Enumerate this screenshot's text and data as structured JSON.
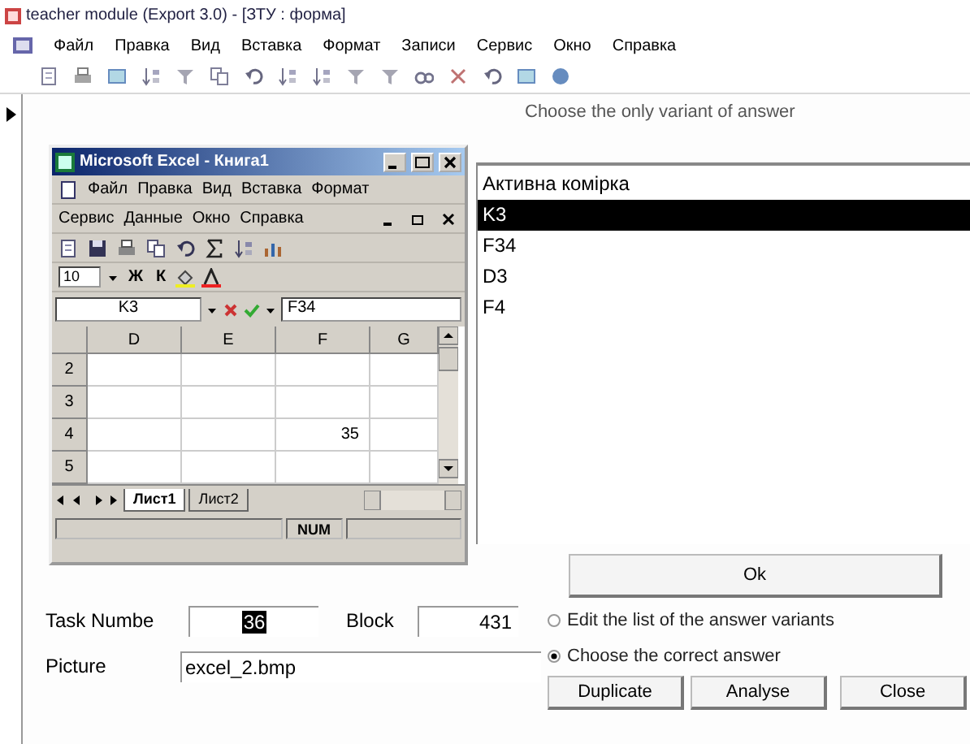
{
  "window": {
    "title": "teacher module (Export 3.0) - [ЗТУ : форма]"
  },
  "menu": [
    "Файл",
    "Правка",
    "Вид",
    "Вставка",
    "Формат",
    "Записи",
    "Сервис",
    "Окно",
    "Справка"
  ],
  "excel": {
    "title": "Microsoft Excel - Книга1",
    "menu_rows": [
      [
        "Файл",
        "Правка",
        "Вид",
        "Вставка",
        "Формат"
      ],
      [
        "Сервис",
        "Данные",
        "Окно",
        "Справка"
      ]
    ],
    "font_size": "10",
    "format_buttons": [
      "Ж",
      "К"
    ],
    "name_box": "K3",
    "formula": "F34",
    "columns": [
      "D",
      "E",
      "F",
      "G"
    ],
    "rows": [
      {
        "header": "2",
        "cells": [
          null,
          null,
          null,
          null
        ]
      },
      {
        "header": "3",
        "cells": [
          null,
          null,
          null,
          null
        ]
      },
      {
        "header": "4",
        "cells": [
          null,
          null,
          "35",
          null
        ]
      },
      {
        "header": "5",
        "cells": [
          null,
          null,
          null,
          null
        ]
      }
    ],
    "sheets": [
      {
        "label": "Лист1",
        "selected": true
      },
      {
        "label": "Лист2",
        "selected": false
      }
    ],
    "status": "NUM"
  },
  "answers": {
    "heading": "Choose the only variant of answer",
    "items": [
      {
        "label": "Активна комірка",
        "selected": false
      },
      {
        "label": "K3",
        "selected": true
      },
      {
        "label": "F34",
        "selected": false
      },
      {
        "label": "D3",
        "selected": false
      },
      {
        "label": "F4",
        "selected": false
      }
    ]
  },
  "ok_button": "Ok",
  "task": {
    "label": "Task Numbe",
    "value": "36"
  },
  "block": {
    "label": "Block",
    "value": "431"
  },
  "picture": {
    "label": "Picture",
    "value": "excel_2.bmp"
  },
  "modes": [
    {
      "label": "Edit the list of the answer variants",
      "selected": false
    },
    {
      "label": "Choose the correct answer",
      "selected": true
    }
  ],
  "buttons": [
    "Duplicate",
    "Analyse",
    "Close"
  ]
}
